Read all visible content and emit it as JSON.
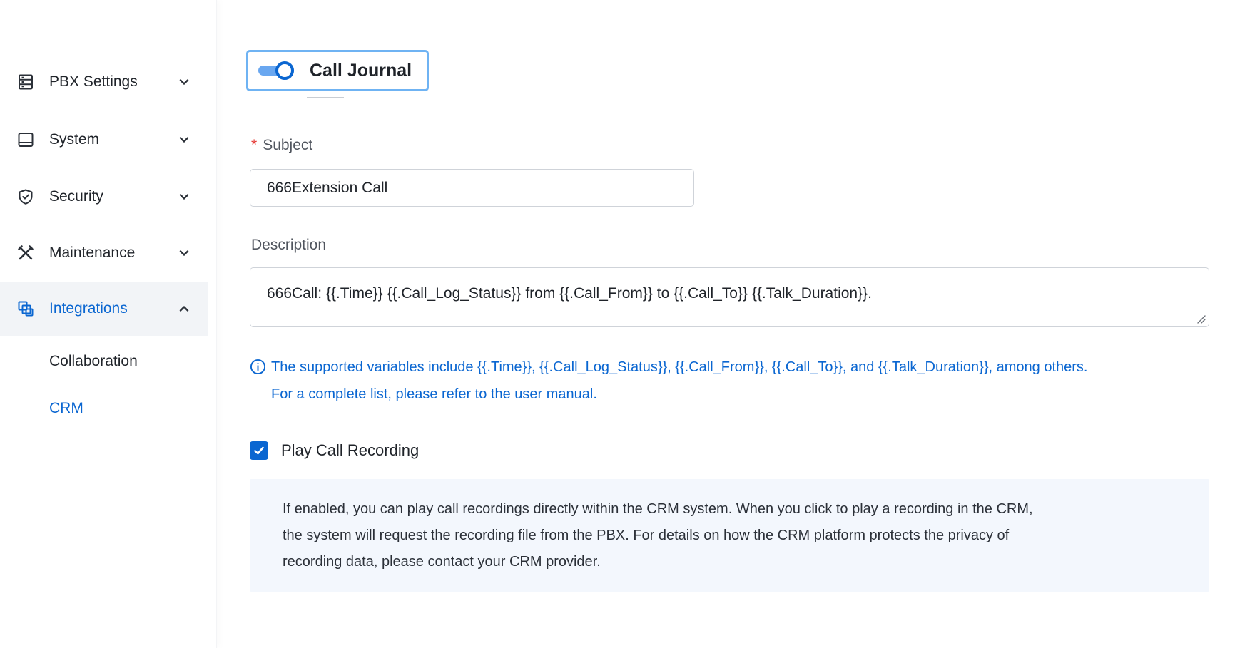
{
  "sidebar": {
    "items": [
      {
        "label": "PBX Settings",
        "icon": "server-list-icon",
        "expanded": false
      },
      {
        "label": "System",
        "icon": "monitor-icon",
        "expanded": false
      },
      {
        "label": "Security",
        "icon": "shield-check-icon",
        "expanded": false
      },
      {
        "label": "Maintenance",
        "icon": "tools-icon",
        "expanded": false
      },
      {
        "label": "Integrations",
        "icon": "integrations-icon",
        "expanded": true,
        "active": true
      }
    ],
    "subitems": [
      {
        "label": "Collaboration",
        "active": false
      },
      {
        "label": "CRM",
        "active": true
      }
    ]
  },
  "tab": {
    "title": "Call Journal",
    "enabled": true
  },
  "form": {
    "subject_label": "Subject",
    "required_mark": "*",
    "subject_value": "666Extension Call",
    "description_label": "Description",
    "description_value": "666Call: {{.Time}} {{.Call_Log_Status}} from {{.Call_From}} to {{.Call_To}} {{.Talk_Duration}}.",
    "hint_line1": "The supported variables include {{.Time}}, {{.Call_Log_Status}}, {{.Call_From}}, {{.Call_To}}, and {{.Talk_Duration}}, among others.",
    "hint_line2": "For a complete list, please refer to the user manual.",
    "play_recording_label": "Play Call Recording",
    "play_recording_checked": true,
    "play_recording_note_line1": "If enabled, you can play call recordings directly within the CRM system. When you click to play a recording in the CRM,",
    "play_recording_note_line2": "the system will request the recording file from the PBX. For details on how the CRM platform protects the privacy of",
    "play_recording_note_line3": "recording data, please contact your CRM provider."
  },
  "colors": {
    "accent": "#0a66d1",
    "tab_border": "#6fb3f3",
    "note_bg": "#f3f7fd",
    "required": "#e53935"
  }
}
